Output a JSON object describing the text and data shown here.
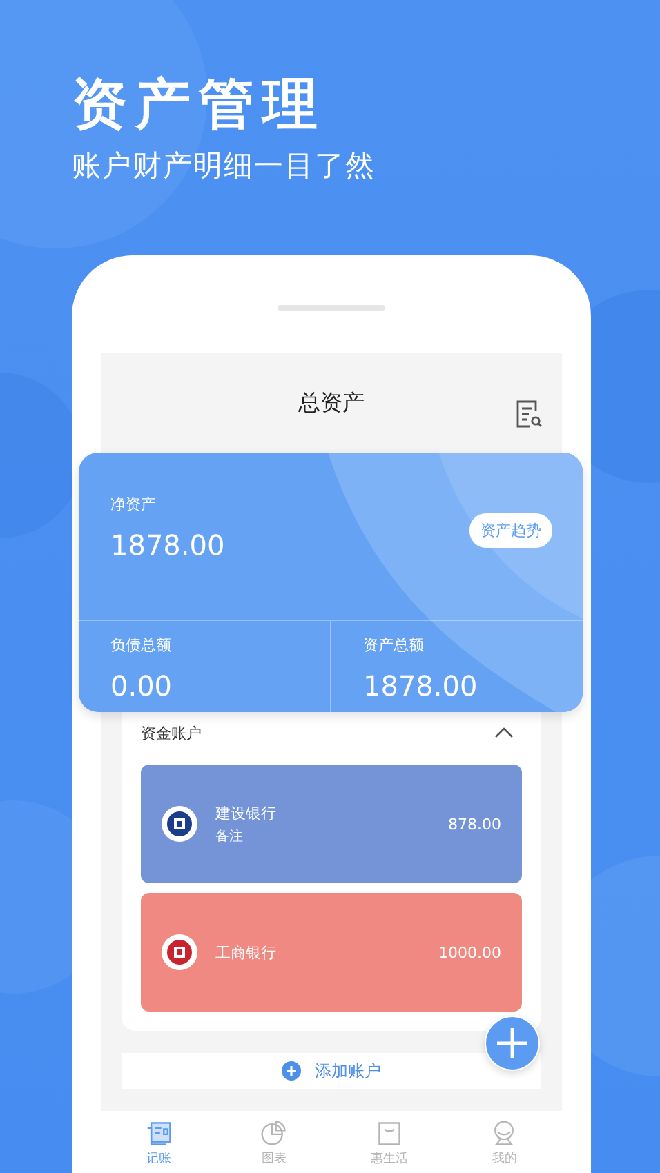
{
  "headline": "资产管理",
  "subheadline": "账户财产明细一目了然",
  "screen": {
    "title": "总资产"
  },
  "net_assets": {
    "label": "净资产",
    "value": "1878.00",
    "trend_button": "资产趋势"
  },
  "totals": [
    {
      "label": "负债总额",
      "value": "0.00"
    },
    {
      "label": "资产总额",
      "value": "1878.00"
    }
  ],
  "accounts": {
    "title": "资金账户",
    "expanded": true,
    "items": [
      {
        "name": "建设银行",
        "note": "备注",
        "amount": "878.00",
        "color": "#7594d8"
      },
      {
        "name": "工商银行",
        "amount": "1000.00",
        "color": "#ef8981"
      }
    ]
  },
  "add_account": "添加账户",
  "tabs": [
    {
      "label": "记账",
      "selected": true
    },
    {
      "label": "图表",
      "selected": false
    },
    {
      "label": "惠生活",
      "selected": false
    },
    {
      "label": "我的",
      "selected": false
    }
  ]
}
